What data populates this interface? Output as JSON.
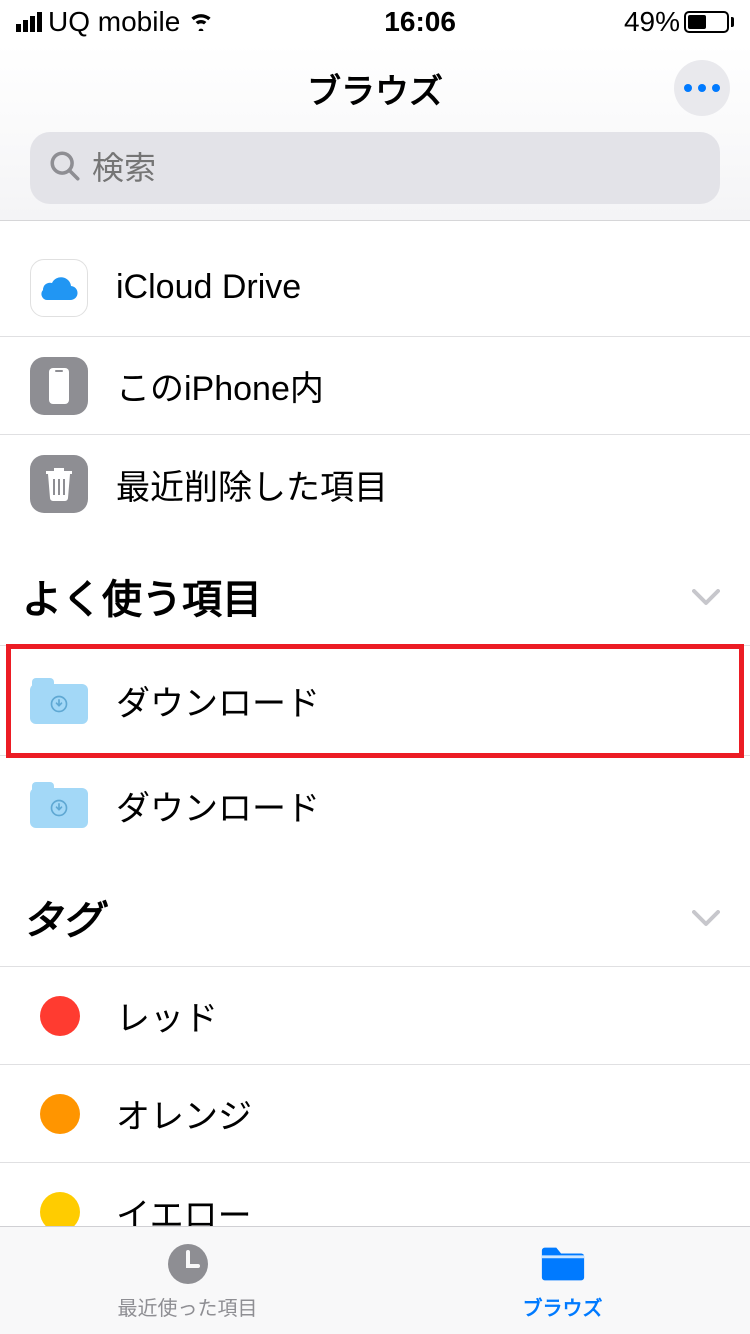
{
  "status": {
    "carrier": "UQ mobile",
    "time": "16:06",
    "battery_pct": "49%"
  },
  "header": {
    "title": "ブラウズ",
    "search_placeholder": "検索"
  },
  "locations": [
    {
      "label": "iCloud Drive",
      "icon": "icloud"
    },
    {
      "label": "このiPhone内",
      "icon": "iphone"
    },
    {
      "label": "最近削除した項目",
      "icon": "trash"
    }
  ],
  "sections": {
    "favorites_title": "よく使う項目",
    "tags_title": "タグ"
  },
  "favorites": [
    {
      "label": "ダウンロード",
      "highlighted": true
    },
    {
      "label": "ダウンロード",
      "highlighted": false
    }
  ],
  "tags": [
    {
      "label": "レッド",
      "color": "#ff3b30"
    },
    {
      "label": "オレンジ",
      "color": "#ff9500"
    },
    {
      "label": "イエロー",
      "color": "#ffcc00"
    }
  ],
  "tabbar": {
    "recent": "最近使った項目",
    "browse": "ブラウズ"
  }
}
